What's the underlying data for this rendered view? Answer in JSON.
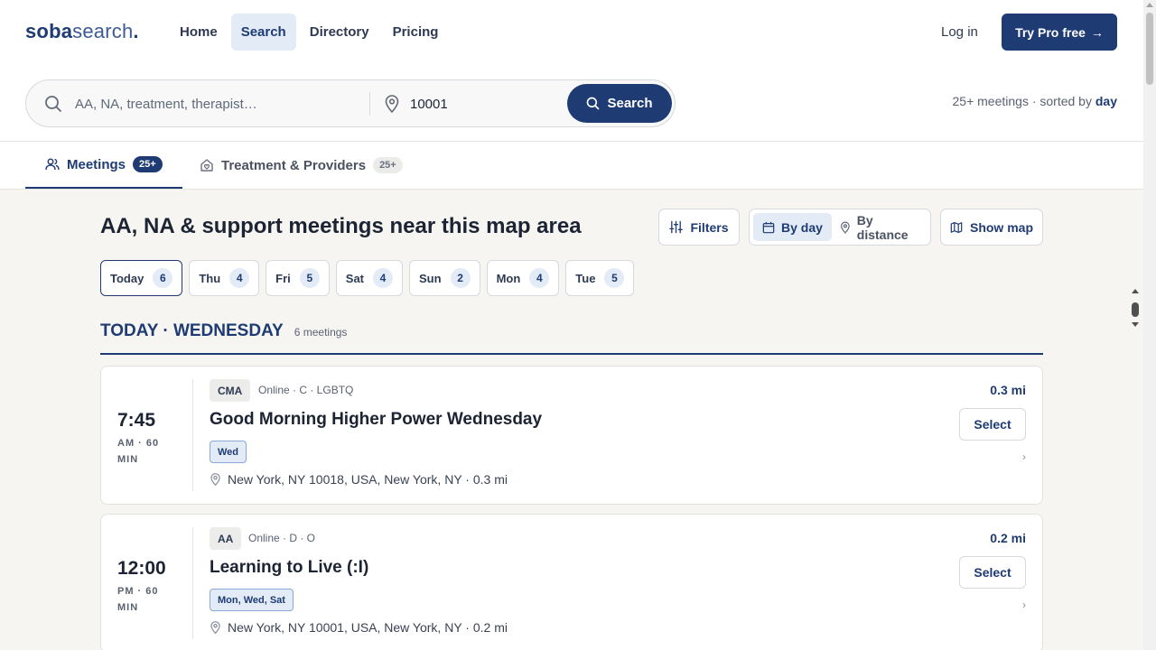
{
  "brand": {
    "bold": "soba",
    "light": "search",
    "dot": "."
  },
  "nav": {
    "links": [
      "Home",
      "Search",
      "Directory",
      "Pricing"
    ],
    "active": "Search",
    "login": "Log in",
    "cta": "Try Pro free",
    "cta_arrow": "→"
  },
  "search": {
    "query_placeholder": "AA, NA, treatment, therapist…",
    "location_value": "10001",
    "button_label": "Search",
    "result_prefix": "25+ meetings · sorted by",
    "result_sort": "day"
  },
  "tabs": [
    {
      "label": "Meetings",
      "badge": "25+",
      "icon": "people-icon",
      "active": true
    },
    {
      "label": "Treatment & Providers",
      "badge": "25+",
      "icon": "home-heart-icon",
      "active": false
    }
  ],
  "page_title": "AA, NA & support meetings near this map area",
  "toolbar": {
    "filters": "Filters",
    "by_day": "By day",
    "by_distance": "By distance",
    "show_map": "Show map"
  },
  "day_chips": [
    {
      "label": "Today",
      "count": "6",
      "active": true
    },
    {
      "label": "Thu",
      "count": "4"
    },
    {
      "label": "Fri",
      "count": "5"
    },
    {
      "label": "Sat",
      "count": "4"
    },
    {
      "label": "Sun",
      "count": "2"
    },
    {
      "label": "Mon",
      "count": "4"
    },
    {
      "label": "Tue",
      "count": "5"
    }
  ],
  "day_header": {
    "title": "TODAY · WEDNESDAY",
    "count": "6 meetings"
  },
  "meetings": [
    {
      "time": "7:45",
      "meta": "AM · 60 MIN",
      "type": "CMA",
      "tags": "Online · C · LGBTQ",
      "title": "Good Morning Higher Power Wednesday",
      "days": "Wed",
      "address": "New York, NY 10018, USA, New York, NY · 0.3 mi",
      "distance": "0.3 mi",
      "select": "Select",
      "chevron": "›"
    },
    {
      "time": "12:00",
      "meta": "PM · 60 MIN",
      "type": "AA",
      "tags": "Online · D · O",
      "title": "Learning to Live (:I)",
      "days": "Mon, Wed, Sat",
      "address": "New York, NY 10001, USA, New York, NY · 0.2 mi",
      "distance": "0.2 mi",
      "select": "Select",
      "chevron": "›"
    }
  ],
  "colors": {
    "primary": "#1e3b73",
    "page_bg": "#f6f5f1",
    "active_tint": "#e3ebf7"
  }
}
